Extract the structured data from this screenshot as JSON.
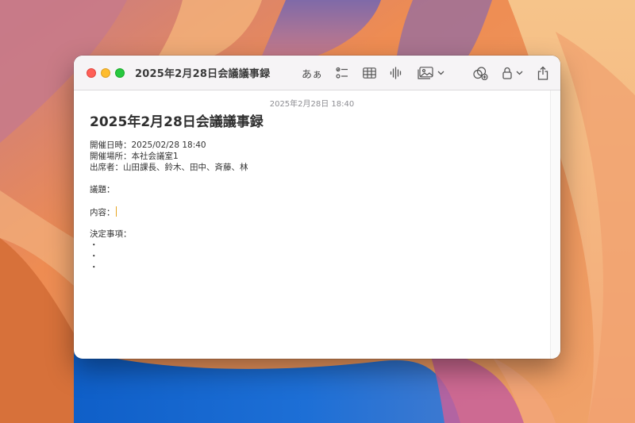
{
  "window": {
    "title": "2025年2月28日会議議事録"
  },
  "toolbar": {
    "font_button": "あぁ",
    "icons": [
      "checklist-icon",
      "table-icon",
      "audio-waveform-icon",
      "media-icon",
      "collaborate-icon",
      "lock-icon",
      "share-icon"
    ]
  },
  "note": {
    "timestamp": "2025年2月28日 18:40",
    "title": "2025年2月28日会議議事録",
    "lines": [
      "開催日時：2025/02/28 18:40",
      "開催場所：本社会議室1",
      "出席者：山田課長、鈴木、田中、斉藤、林",
      "議題：",
      "内容：",
      "決定事項：",
      "・",
      "・",
      "・"
    ]
  },
  "colors": {
    "close": "#ff5f57",
    "minimize": "#febc2e",
    "maximize": "#28c840",
    "caret": "#e6a623"
  }
}
